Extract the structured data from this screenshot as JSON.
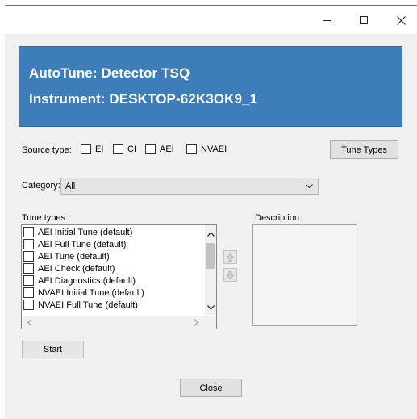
{
  "window": {
    "controls": {
      "minimize": "minimize-icon",
      "maximize": "maximize-icon",
      "close": "close-icon"
    }
  },
  "header": {
    "line1": "AutoTune: Detector TSQ",
    "line2": "Instrument: DESKTOP-62K3OK9_1",
    "background": "#3c7dba",
    "text_color": "#ffffff"
  },
  "source_type": {
    "label": "Source type:",
    "options": [
      {
        "label": "EI",
        "checked": false
      },
      {
        "label": "CI",
        "checked": false
      },
      {
        "label": "AEI",
        "checked": false
      },
      {
        "label": "NVAEI",
        "checked": false
      }
    ]
  },
  "tune_types_button": "Tune Types",
  "category": {
    "label": "Category:",
    "selected": "All",
    "arrow_icon": "chevron-down-icon"
  },
  "tune_types": {
    "label": "Tune types:",
    "items": [
      {
        "label": "AEI Initial Tune (default)",
        "checked": false
      },
      {
        "label": "AEI Full Tune (default)",
        "checked": false
      },
      {
        "label": "AEI Tune (default)",
        "checked": false
      },
      {
        "label": "AEI Check (default)",
        "checked": false
      },
      {
        "label": "AEI Diagnostics (default)",
        "checked": false
      },
      {
        "label": "NVAEI Initial Tune (default)",
        "checked": false
      },
      {
        "label": "NVAEI Full Tune (default)",
        "checked": false
      }
    ]
  },
  "description": {
    "label": "Description:",
    "text": ""
  },
  "move_buttons": {
    "up": "arrow-up-icon",
    "down": "arrow-down-icon"
  },
  "start_button": "Start",
  "close_button": "Close"
}
